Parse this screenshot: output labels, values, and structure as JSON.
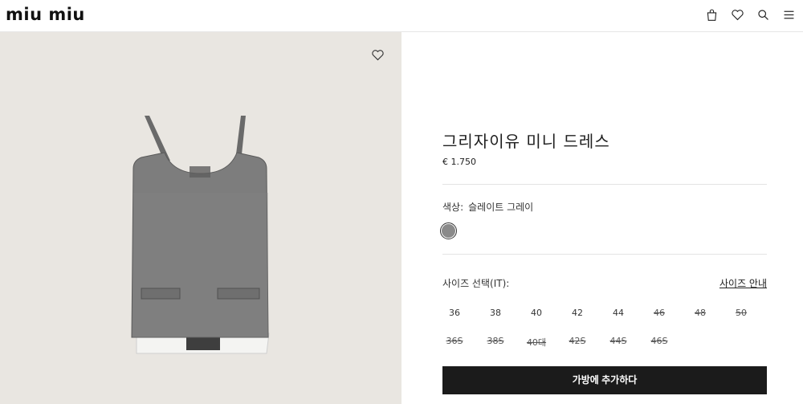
{
  "header": {
    "logo": "miu miu",
    "icons": [
      "bag-icon",
      "heart-icon",
      "search-icon",
      "menu-icon"
    ]
  },
  "product": {
    "title": "그리자이유 미니 드레스",
    "price": "€ 1.750",
    "color_label": "색상:",
    "color_value": "슬레이트 그레이",
    "swatch_color": "#8a8a8a",
    "size_label": "사이즈 선택(IT):",
    "size_guide": "사이즈 안내",
    "sizes_row1": [
      {
        "label": "36",
        "available": true
      },
      {
        "label": "38",
        "available": true
      },
      {
        "label": "40",
        "available": true
      },
      {
        "label": "42",
        "available": true
      },
      {
        "label": "44",
        "available": true
      },
      {
        "label": "46",
        "available": false
      },
      {
        "label": "48",
        "available": false
      },
      {
        "label": "50",
        "available": false
      }
    ],
    "sizes_row2": [
      {
        "label": "36S",
        "available": false
      },
      {
        "label": "38S",
        "available": false
      },
      {
        "label": "40대",
        "available": false
      },
      {
        "label": "42S",
        "available": false
      },
      {
        "label": "44S",
        "available": false
      },
      {
        "label": "46S",
        "available": false
      }
    ],
    "add_to_bag": "가방에 추가하다"
  }
}
